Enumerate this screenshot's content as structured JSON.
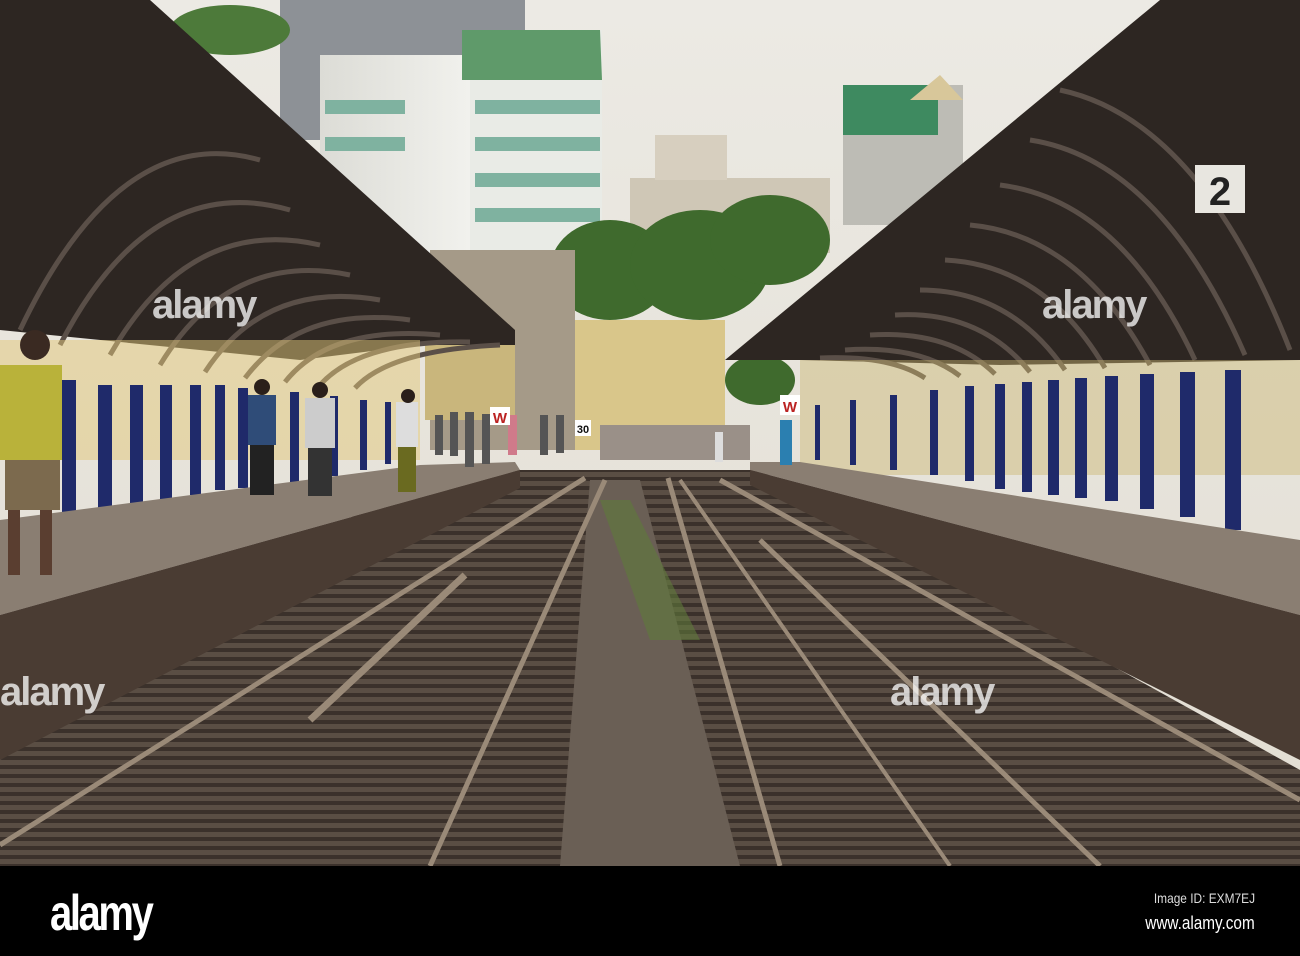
{
  "watermark": {
    "text": "alamy"
  },
  "signs": {
    "platform_number": "2",
    "w_left": "W",
    "w_right": "W",
    "speed": "30"
  },
  "footer": {
    "logo": "alamy",
    "image_id": "Image ID: EXM7EJ",
    "url": "www.alamy.com"
  }
}
